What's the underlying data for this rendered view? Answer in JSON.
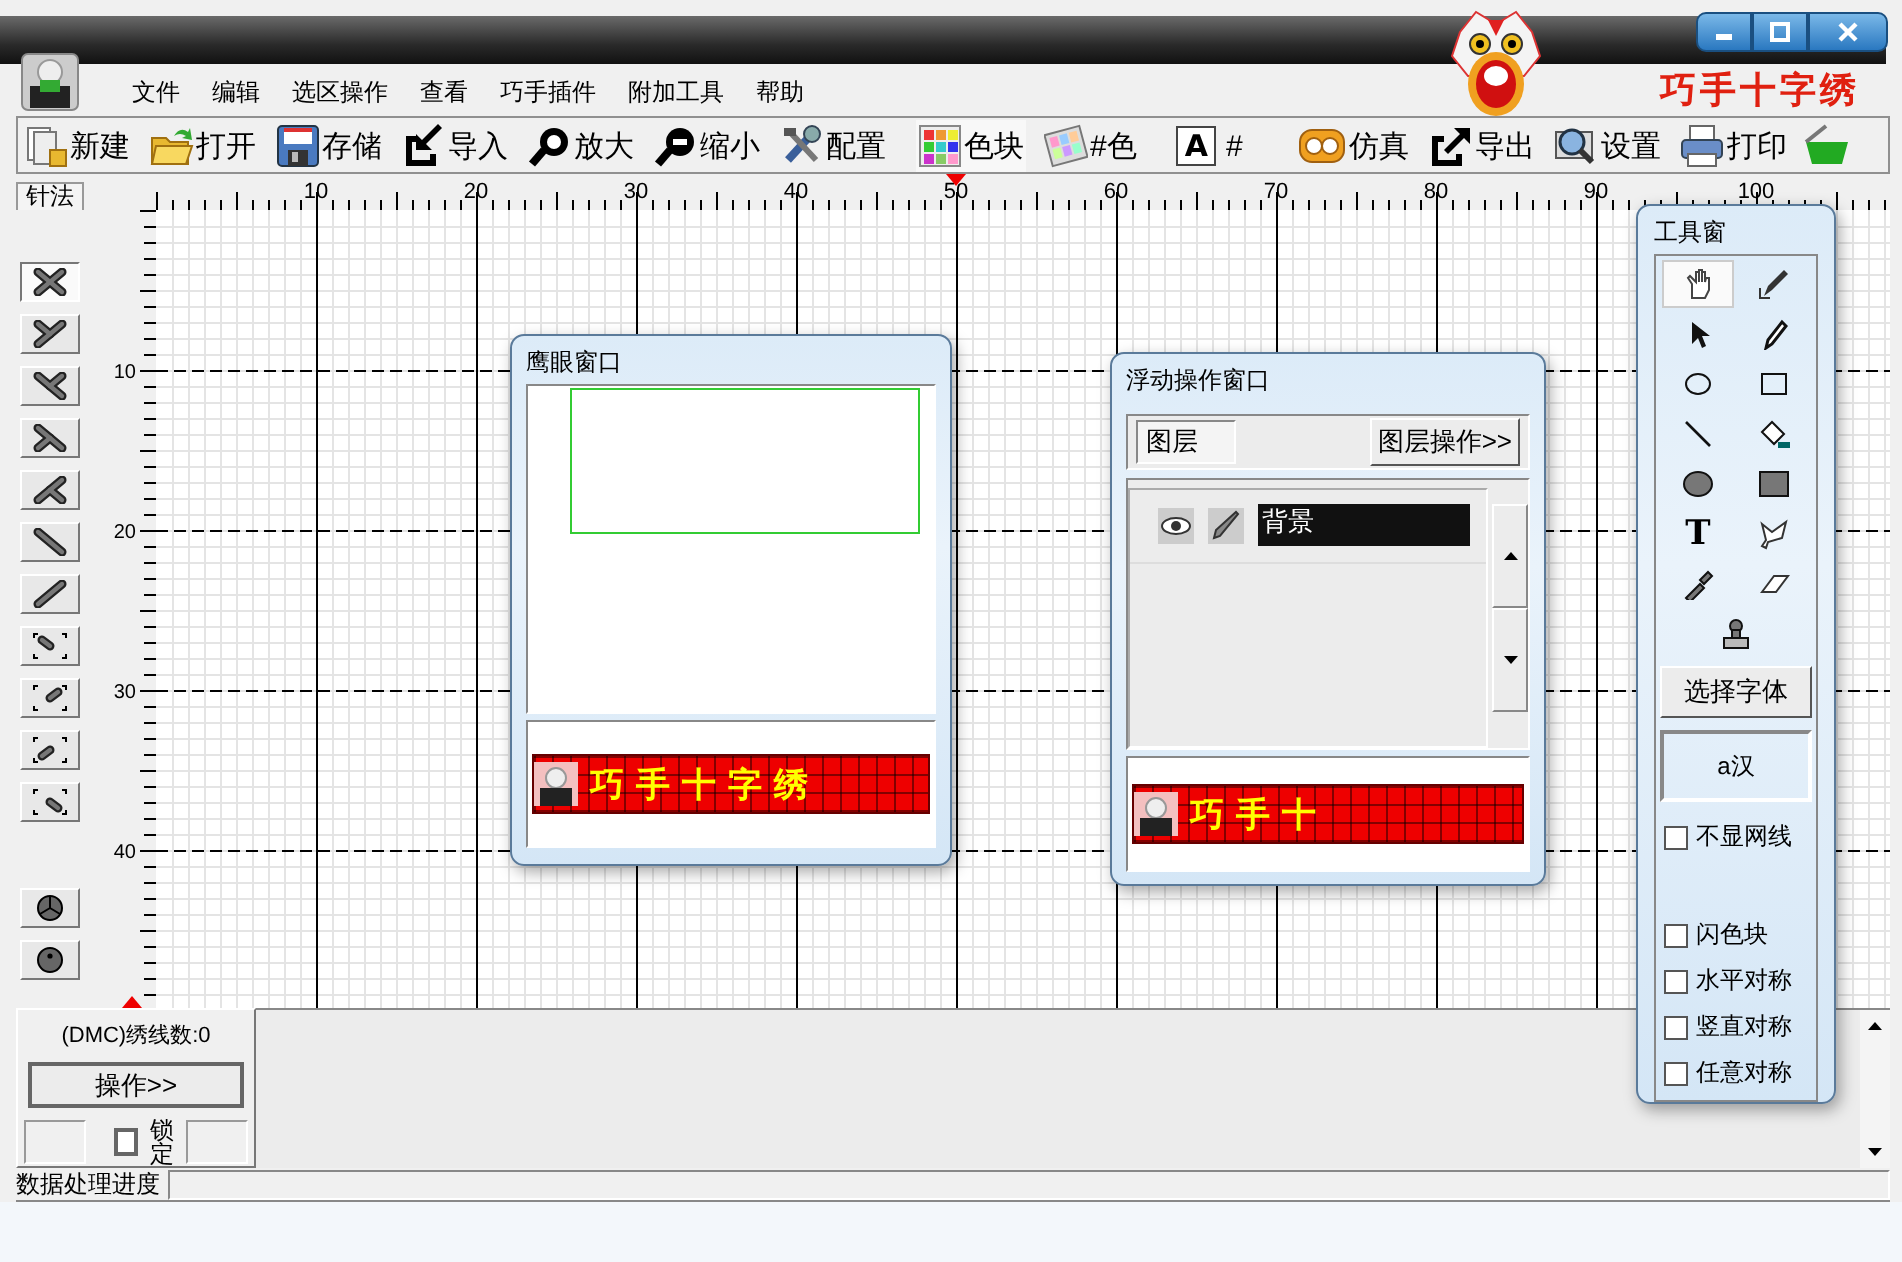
{
  "title_bar": {
    "brand": "巧手十字绣"
  },
  "menu": [
    "文件",
    "编辑",
    "选区操作",
    "查看",
    "巧手插件",
    "附加工具",
    "帮助"
  ],
  "toolbar": [
    {
      "label": "新建"
    },
    {
      "label": "打开"
    },
    {
      "label": "存储"
    },
    {
      "label": "导入"
    },
    {
      "label": "放大"
    },
    {
      "label": "缩小"
    },
    {
      "label": "配置"
    },
    {
      "label": "色块"
    },
    {
      "label": "#色"
    },
    {
      "label": "#",
      "glyph": "A"
    },
    {
      "label": "仿真"
    },
    {
      "label": "导出"
    },
    {
      "label": "设置"
    },
    {
      "label": "打印"
    }
  ],
  "ruler": {
    "corner_label": "针法",
    "x_ticks": [
      "10",
      "20",
      "30",
      "40",
      "50",
      "60",
      "70",
      "80",
      "90",
      "100"
    ],
    "y_ticks": [
      "10",
      "20",
      "30",
      "40"
    ]
  },
  "stitch_tools": [
    {
      "selected": true
    },
    {
      "selected": false
    },
    {
      "selected": false
    },
    {
      "selected": false
    },
    {
      "selected": false
    },
    {
      "selected": false
    },
    {
      "selected": false
    },
    {
      "selected": false
    },
    {
      "selected": false
    },
    {
      "selected": false
    },
    {
      "selected": false
    },
    {
      "selected": false
    },
    {
      "selected": false
    }
  ],
  "eagle_eye_window": {
    "title": "鹰眼窗口",
    "banner_text": "巧手十字绣"
  },
  "float_window": {
    "title": "浮动操作窗口",
    "tab": "图层",
    "button": "图层操作>>",
    "layers": [
      {
        "name": "背景",
        "selected": true
      }
    ],
    "banner_text": "巧手十"
  },
  "tool_window": {
    "title": "工具窗",
    "tools": [
      {
        "selected": true
      },
      {
        "selected": false
      },
      {
        "selected": false
      },
      {
        "selected": false
      },
      {
        "selected": false
      },
      {
        "selected": false
      },
      {
        "selected": false
      },
      {
        "selected": false
      },
      {
        "selected": false
      },
      {
        "selected": false
      },
      {
        "selected": false,
        "glyph": "T"
      },
      {
        "selected": false
      },
      {
        "selected": false
      },
      {
        "selected": false
      },
      {
        "selected": false
      }
    ],
    "font_button": "选择字体",
    "font_preview": "a汉",
    "options": [
      {
        "label": "不显网线",
        "checked": false
      },
      {
        "label": "闪色块",
        "checked": false
      },
      {
        "label": "水平对称",
        "checked": false
      },
      {
        "label": "竖直对称",
        "checked": false
      },
      {
        "label": "任意对称",
        "checked": false
      }
    ]
  },
  "bottom_panel": {
    "thread_count": "(DMC)绣线数:0",
    "button": "操作>>",
    "lock": {
      "label": "锁定",
      "checked": false
    }
  },
  "status_bar": {
    "label": "数据处理进度",
    "level": 0
  }
}
